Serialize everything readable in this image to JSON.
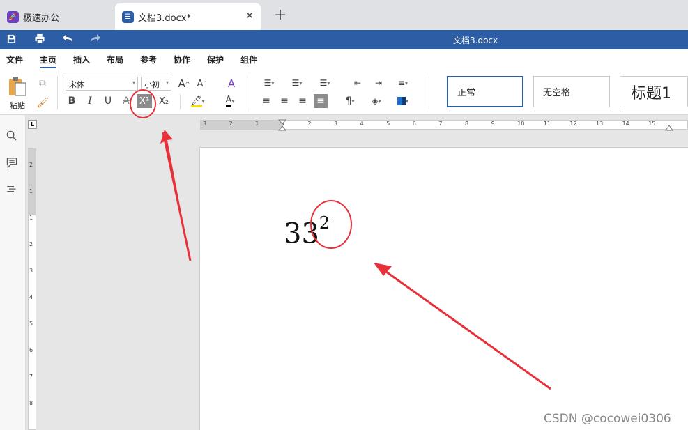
{
  "tabs": [
    {
      "label": "极速办公",
      "icon": "rocket-icon",
      "color": "#6a3fc4"
    },
    {
      "label": "文档3.docx*",
      "icon": "document-icon",
      "color": "#2d5ea5"
    }
  ],
  "titlebar": {
    "title": "文档3.docx",
    "color": "#2d5ea5"
  },
  "menu": [
    "文件",
    "主页",
    "插入",
    "布局",
    "参考",
    "协作",
    "保护",
    "组件"
  ],
  "ribbon": {
    "paste_label": "粘贴",
    "font_name": "宋体",
    "font_size": "小初",
    "bold": "B",
    "italic": "I",
    "underline": "U",
    "strike": "A",
    "superscript": "X²",
    "subscript": "X₂",
    "styles": [
      "正常",
      "无空格",
      "标题1"
    ]
  },
  "rulers": {
    "horizontal_ticks": [
      "3",
      "2",
      "1",
      "1",
      "2",
      "3",
      "4",
      "5",
      "6",
      "7",
      "8",
      "9",
      "10",
      "11",
      "12",
      "13",
      "14",
      "15"
    ],
    "vertical_ticks": [
      "2",
      "1",
      "1",
      "2",
      "3",
      "4",
      "5",
      "6",
      "7",
      "8"
    ]
  },
  "document": {
    "base": "33",
    "superscript": "2"
  },
  "annotation_color": "#e8303a",
  "watermark": "CSDN @cocowei0306"
}
